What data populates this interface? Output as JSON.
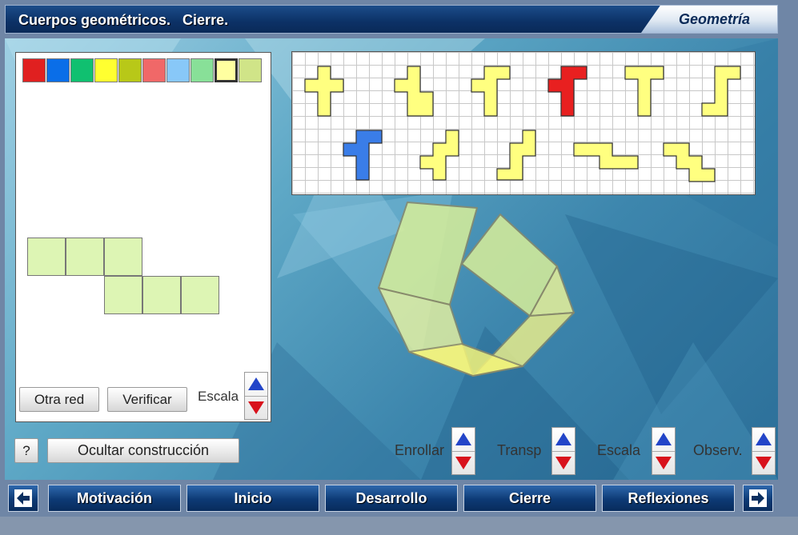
{
  "header": {
    "title": "Cuerpos geométricos.   Cierre.",
    "subject": "Geometría"
  },
  "left_panel": {
    "palette": [
      {
        "color": "#e02020",
        "selected": false
      },
      {
        "color": "#0a6ee8",
        "selected": false
      },
      {
        "color": "#10c070",
        "selected": false
      },
      {
        "color": "#ffff30",
        "selected": false
      },
      {
        "color": "#b8c818",
        "selected": false
      },
      {
        "color": "#f06868",
        "selected": false
      },
      {
        "color": "#88c8f8",
        "selected": false
      },
      {
        "color": "#88e098",
        "selected": false
      },
      {
        "color": "#ffffa0",
        "selected": true
      },
      {
        "color": "#d0e488",
        "selected": false
      }
    ],
    "net_cell_color": "#ddf5b4",
    "otra_red_label": "Otra red",
    "verificar_label": "Verificar",
    "escala_label": "Escala"
  },
  "help_label": "?",
  "ocultar_label": "Ocultar construcción",
  "controls": [
    {
      "label": "Enrollar"
    },
    {
      "label": "Transp"
    },
    {
      "label": "Escala"
    },
    {
      "label": "Observ."
    }
  ],
  "nets_panel": {
    "default_color": "#ffff80",
    "highlight_colors": {
      "red": "#e82020",
      "blue": "#3a7de8"
    }
  },
  "nav": {
    "prev_icon": "arrow-left-icon",
    "next_icon": "arrow-right-icon",
    "items": [
      "Motivación",
      "Inicio",
      "Desarrollo",
      "Cierre",
      "Reflexiones"
    ]
  }
}
